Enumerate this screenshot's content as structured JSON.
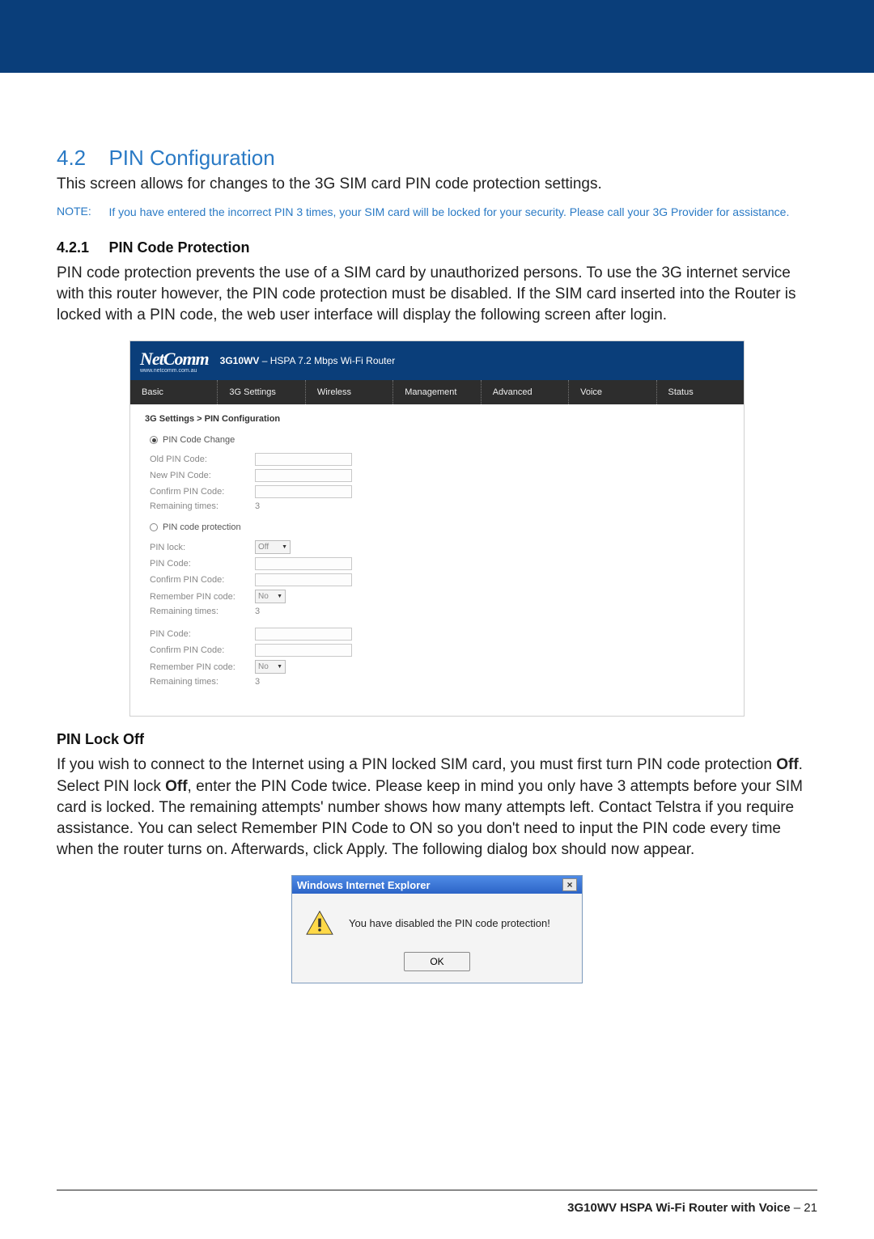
{
  "section": {
    "num": "4.2",
    "title": "PIN Configuration"
  },
  "intro": "This screen allows for changes to the 3G SIM card PIN code protection settings.",
  "note": {
    "label": "NOTE:",
    "text": "If you have entered the incorrect PIN 3 times, your SIM card will be locked for your security. Please call your 3G Provider for assistance."
  },
  "sub": {
    "num": "4.2.1",
    "title": "PIN Code Protection"
  },
  "para1": "PIN code protection prevents the use of a SIM card by unauthorized persons. To use the 3G internet service with this router however, the PIN code protection must be disabled. If the SIM card inserted into the Router is locked with a PIN code, the web user interface will display the following screen after login.",
  "router": {
    "logo": "NetComm",
    "logo_sub": "www.netcomm.com.au",
    "model_num": "3G10WV",
    "model_rest": " – HSPA 7.2 Mbps Wi-Fi Router",
    "nav": [
      "Basic",
      "3G Settings",
      "Wireless",
      "Management",
      "Advanced",
      "Voice",
      "Status"
    ],
    "breadcrumb": "3G Settings > PIN Configuration",
    "group1": {
      "radio": "PIN Code Change",
      "rows": {
        "old": "Old PIN Code:",
        "newp": "New PIN Code:",
        "confirm": "Confirm PIN Code:",
        "remain_l": "Remaining times:",
        "remain_v": "3"
      }
    },
    "group2": {
      "radio": "PIN code protection",
      "rows": {
        "lock_l": "PIN lock:",
        "lock_v": "Off",
        "code": "PIN Code:",
        "confirm": "Confirm PIN Code:",
        "remember_l": "Remember PIN code:",
        "remember_v": "No",
        "remain_l": "Remaining times:",
        "remain_v": "3"
      }
    },
    "group3": {
      "rows": {
        "code": "PIN Code:",
        "confirm": "Confirm PIN Code:",
        "remember_l": "Remember PIN code:",
        "remember_v": "No",
        "remain_l": "Remaining times:",
        "remain_v": "3"
      }
    }
  },
  "h4": "PIN Lock Off",
  "para2_a": "If you wish to connect to the Internet using a PIN locked SIM card, you must first turn PIN code protection ",
  "para2_off1": "Off",
  "para2_b": ". Select PIN lock ",
  "para2_off2": "Off",
  "para2_c": ", enter the PIN Code twice. Please keep in mind you only have 3 attempts before your SIM card is locked. The remaining attempts' number shows how many attempts left. Contact Telstra if you require assistance. You can select Remember PIN Code to ON so you don't need to input the PIN code every time when the router turns on. Afterwards, click Apply. The following dialog box should now appear.",
  "dialog": {
    "title": "Windows Internet Explorer",
    "msg": "You have disabled the PIN code protection!",
    "ok": "OK"
  },
  "footer": {
    "bold": "3G10WV HSPA Wi-Fi Router with Voice",
    "page": " – 21"
  }
}
